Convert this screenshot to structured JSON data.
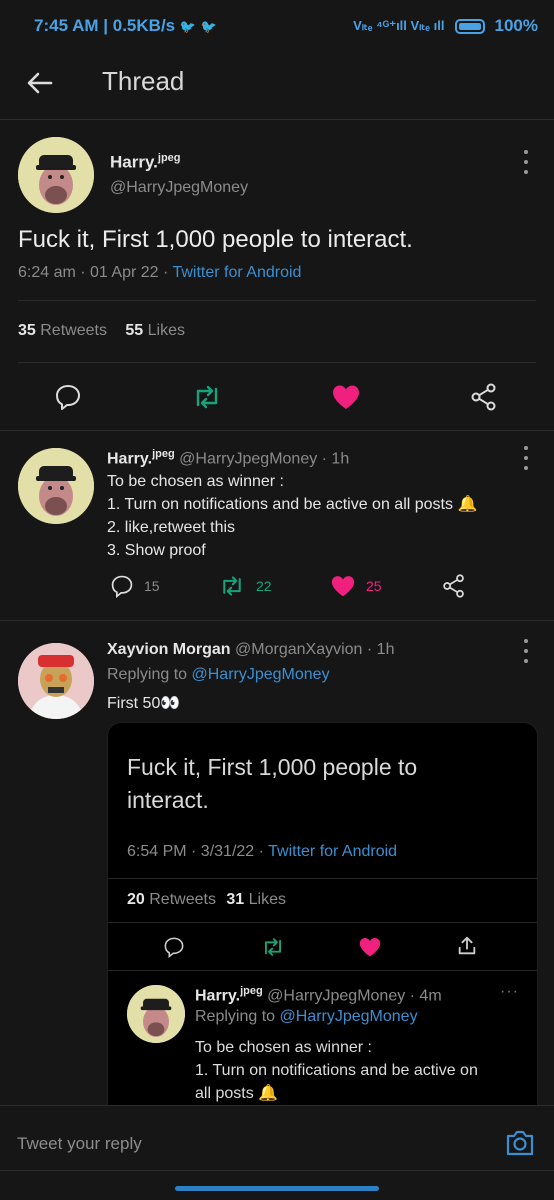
{
  "status_bar": {
    "time_speed": "7:45 AM | 0.5KB/s",
    "network": "Vₗₜₑ ⁴ᴳ⁺ıll Vₗₜₑ ıll",
    "battery": "100%"
  },
  "header": {
    "title": "Thread"
  },
  "main_tweet": {
    "display_name": "Harry.",
    "name_suffix": "jpeg",
    "handle": "@HarryJpegMoney",
    "text": "Fuck it, First 1,000 people to interact.",
    "time_date": "6:24 am · 01 Apr 22 · ",
    "source": "Twitter for Android",
    "retweets_count": "35",
    "retweets_label": "Retweets",
    "likes_count": "55",
    "likes_label": "Likes"
  },
  "reply1": {
    "display_name": "Harry.",
    "name_suffix": "jpeg",
    "handle_time": "@HarryJpegMoney · 1h",
    "lines": [
      "To be chosen as winner :",
      "1. Turn on notifications and be active on all posts 🔔",
      "2. like,retweet this",
      "3. Show proof"
    ],
    "reply_count": "15",
    "retweet_count": "22",
    "like_count": "25"
  },
  "reply2": {
    "display_name": "Xayvion Morgan",
    "handle_time": "@MorganXayvion · 1h",
    "replying_prefix": "Replying to ",
    "replying_to": "@HarryJpegMoney",
    "text": "First 50👀",
    "quote": {
      "text": "Fuck it, First 1,000 people to interact.",
      "time_date": "6:54 PM · 3/31/22 · ",
      "source": "Twitter for Android",
      "retweets_count": "20",
      "retweets_label": "Retweets",
      "likes_count": "31",
      "likes_label": "Likes",
      "nested": {
        "display_name": "Harry.",
        "name_suffix": "jpeg",
        "handle_time": "@HarryJpegMoney · 4m",
        "replying_prefix": "Replying to ",
        "replying_to": "@HarryJpegMoney",
        "lines": [
          "To be chosen as winner :",
          "1. Turn on notifications and be active on",
          "all posts 🔔"
        ]
      }
    }
  },
  "reply_box": {
    "placeholder": "Tweet your reply"
  },
  "colors": {
    "accent": "#3b8fd0",
    "retweet": "#17a37a",
    "like": "#f0207f",
    "background": "#161616"
  }
}
